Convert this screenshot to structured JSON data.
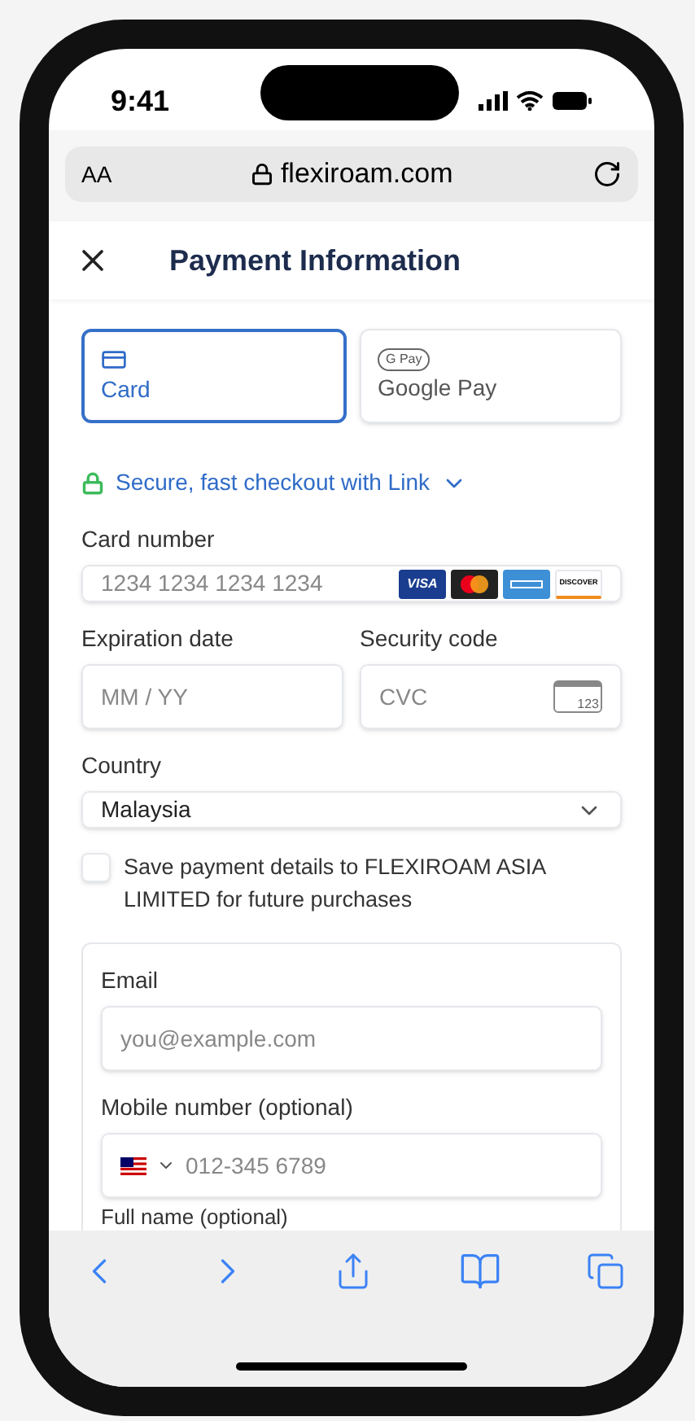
{
  "status_bar": {
    "time": "9:41"
  },
  "browser": {
    "text_size_label": "AA",
    "url": "flexiroam.com"
  },
  "header": {
    "title": "Payment Information"
  },
  "payment_tabs": [
    {
      "kind": "card",
      "label": "Card",
      "selected": true
    },
    {
      "kind": "gpay",
      "badge": "G Pay",
      "label": "Google Pay",
      "selected": false
    }
  ],
  "link_banner": {
    "label": "Secure, fast checkout with Link"
  },
  "card_number": {
    "label": "Card number",
    "placeholder": "1234 1234 1234 1234",
    "brands": [
      {
        "kind": "visa",
        "label": "VISA"
      },
      {
        "kind": "mastercard"
      },
      {
        "kind": "amex"
      },
      {
        "kind": "discover",
        "label": "DISCOVER"
      }
    ]
  },
  "expiration": {
    "label": "Expiration date",
    "placeholder": "MM / YY"
  },
  "security_code": {
    "label": "Security code",
    "placeholder": "CVC",
    "icon_text": "123"
  },
  "country": {
    "label": "Country",
    "value": "Malaysia"
  },
  "save_details": {
    "label": "Save payment details to FLEXIROAM ASIA LIMITED for future purchases",
    "checked": false
  },
  "link_form": {
    "email": {
      "label": "Email",
      "placeholder": "you@example.com"
    },
    "mobile": {
      "label": "Mobile number (optional)",
      "placeholder": "012-345 6789"
    },
    "full_name": {
      "label": "Full name (optional)"
    }
  }
}
